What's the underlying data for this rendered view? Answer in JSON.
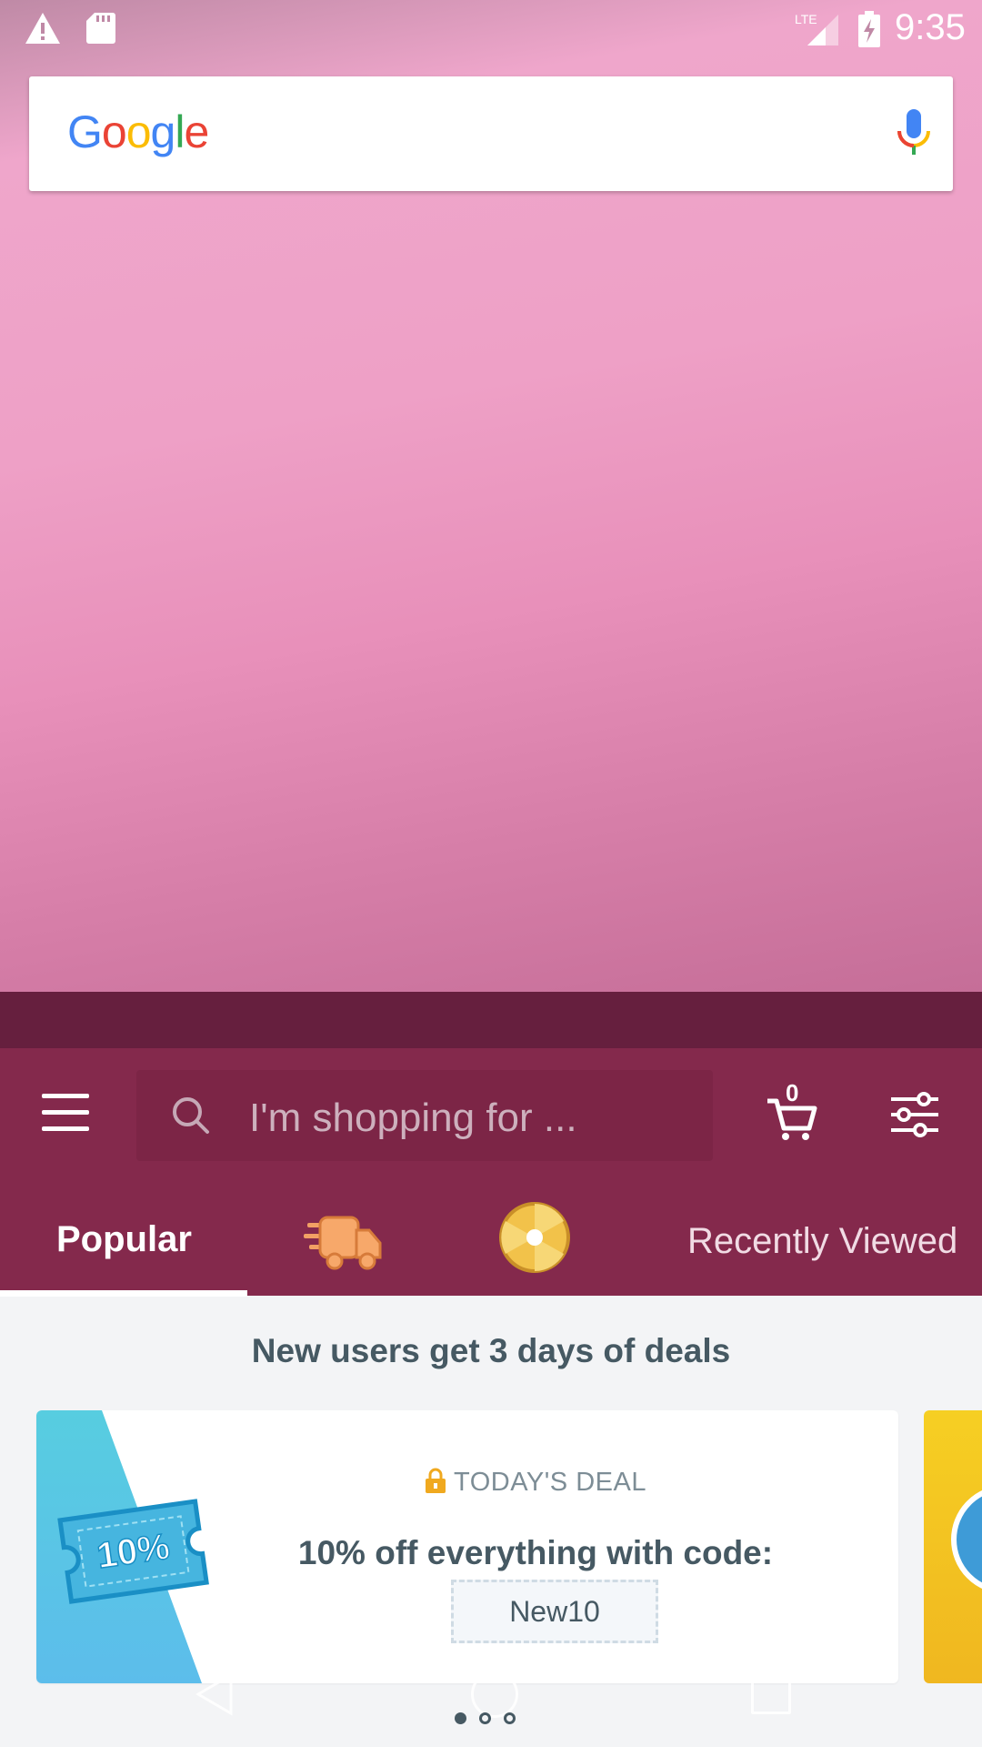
{
  "status_bar": {
    "time": "9:35",
    "network": "LTE",
    "icons": [
      "warning-icon",
      "sd-card-icon",
      "signal-icon",
      "battery-charging-icon"
    ]
  },
  "google_bar": {
    "logo_letters": [
      "G",
      "o",
      "o",
      "g",
      "l",
      "e"
    ],
    "logo_colors": [
      "#4285F4",
      "#EA4335",
      "#FBBC05",
      "#4285F4",
      "#34A853",
      "#EA4335"
    ],
    "mic_icon": "mic-icon"
  },
  "toolbar": {
    "search_placeholder": "I'm shopping for ...",
    "cart_count": "0",
    "icons": [
      "menu-icon",
      "search-icon",
      "cart-icon",
      "filter-icon"
    ]
  },
  "tabs": [
    {
      "label": "Popular",
      "selected": true
    },
    {
      "label": "",
      "icon": "delivery-truck-icon"
    },
    {
      "label": "",
      "icon": "prize-wheel-icon"
    },
    {
      "label": "Recently Viewed"
    }
  ],
  "content": {
    "headline": "New users get 3 days of deals",
    "deal": {
      "badge_text": "10%",
      "kicker": "TODAY'S DEAL",
      "title": "10% off everything with code:",
      "code": "New10"
    },
    "carousel_pages": 3,
    "carousel_active": 1
  },
  "colors": {
    "app_primary": "#84294C",
    "app_dark": "#661F3E",
    "text_dark": "#465963",
    "deal_blue": "#5BC3E6"
  }
}
